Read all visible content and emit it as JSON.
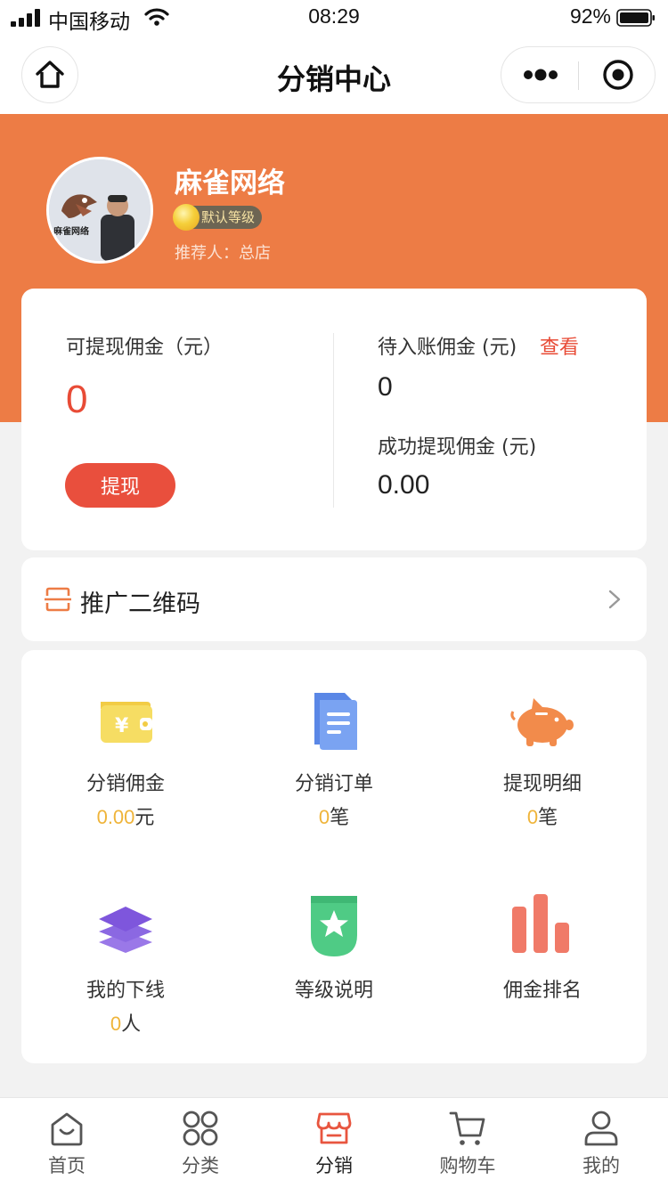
{
  "status_bar": {
    "carrier": "中国移动",
    "time": "08:29",
    "battery": "92%"
  },
  "nav": {
    "title": "分销中心",
    "home_icon": "home-icon",
    "more_icon": "more-dots-icon",
    "close_icon": "target-close-icon"
  },
  "profile": {
    "name": "麻雀网络",
    "level": "默认等级",
    "referrer": "推荐人：总店",
    "avatar_logo_text": "麻雀网络"
  },
  "commission": {
    "withdrawable_label": "可提现佣金（元）",
    "withdrawable_value": "0",
    "withdraw_button": "提现",
    "pending_label": "待入账佣金 (元)",
    "view_link": "查看",
    "pending_value": "0",
    "success_label": "成功提现佣金 (元)",
    "success_value": "0.00"
  },
  "qr": {
    "label": "推广二维码"
  },
  "grid": [
    {
      "title": "分销佣金",
      "num": "0.00",
      "unit": "元",
      "icon": "wallet-icon"
    },
    {
      "title": "分销订单",
      "num": "0",
      "unit": "笔",
      "icon": "document-icon"
    },
    {
      "title": "提现明细",
      "num": "0",
      "unit": "笔",
      "icon": "piggy-bank-icon"
    },
    {
      "title": "我的下线",
      "num": "0",
      "unit": "人",
      "icon": "layers-icon"
    },
    {
      "title": "等级说明",
      "num": "",
      "unit": "",
      "icon": "badge-star-icon"
    },
    {
      "title": "佣金排名",
      "num": "",
      "unit": "",
      "icon": "bar-chart-icon"
    }
  ],
  "tabs": [
    {
      "label": "首页",
      "icon": "home-tab-icon"
    },
    {
      "label": "分类",
      "icon": "category-icon"
    },
    {
      "label": "分销",
      "icon": "store-icon",
      "active": true
    },
    {
      "label": "购物车",
      "icon": "cart-icon"
    },
    {
      "label": "我的",
      "icon": "user-icon"
    }
  ],
  "colors": {
    "header": "#ed7c45",
    "accent_red": "#e94f3d",
    "number_yellow": "#efb43a"
  }
}
